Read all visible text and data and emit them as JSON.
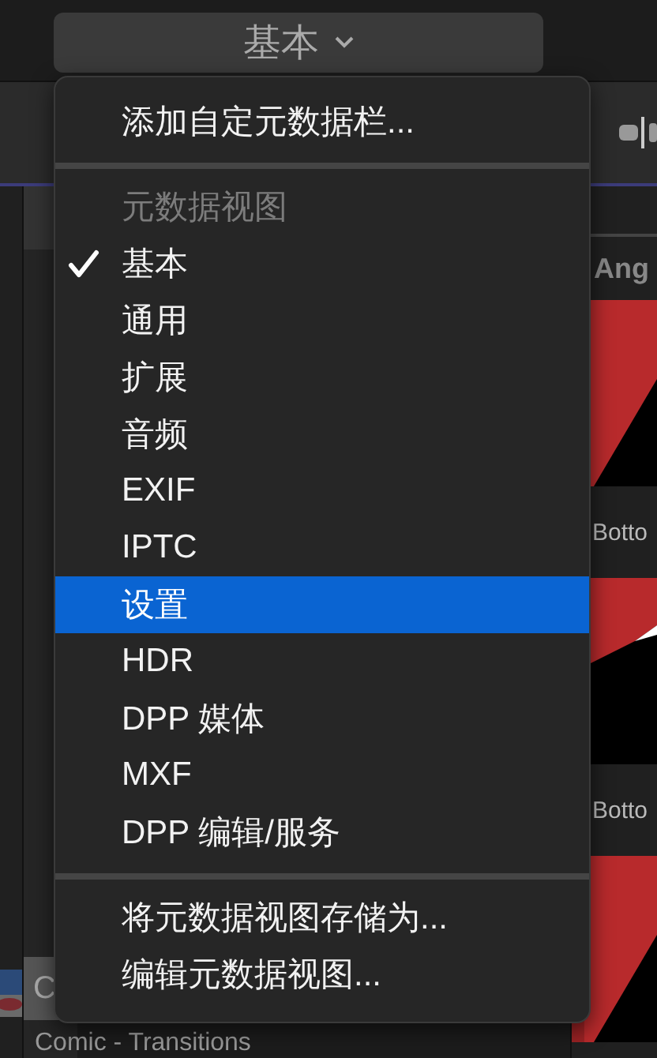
{
  "header_button": {
    "label": "基本"
  },
  "sidebar": {
    "items": [
      {
        "label": "C",
        "selected": true
      }
    ]
  },
  "browser": {
    "column_header": "Ang",
    "clips": [
      {
        "kind": "picture",
        "name": "Botto"
      },
      {
        "kind": "picture",
        "name": "Botto"
      },
      {
        "kind": "picture"
      }
    ],
    "footer_label": "Comic - Transitions"
  },
  "menu": {
    "items": [
      {
        "kind": "action",
        "label": "添加自定元数据栏..."
      },
      {
        "kind": "separator"
      },
      {
        "kind": "header",
        "label": "元数据视图"
      },
      {
        "kind": "view",
        "label": "基本",
        "checked": true,
        "selected": false
      },
      {
        "kind": "view",
        "label": "通用",
        "checked": false,
        "selected": false
      },
      {
        "kind": "view",
        "label": "扩展",
        "checked": false,
        "selected": false
      },
      {
        "kind": "view",
        "label": "音频",
        "checked": false,
        "selected": false
      },
      {
        "kind": "view",
        "label": "EXIF",
        "checked": false,
        "selected": false
      },
      {
        "kind": "view",
        "label": "IPTC",
        "checked": false,
        "selected": false
      },
      {
        "kind": "view",
        "label": "设置",
        "checked": false,
        "selected": true
      },
      {
        "kind": "view",
        "label": "HDR",
        "checked": false,
        "selected": false
      },
      {
        "kind": "view",
        "label": "DPP 媒体",
        "checked": false,
        "selected": false
      },
      {
        "kind": "view",
        "label": "MXF",
        "checked": false,
        "selected": false
      },
      {
        "kind": "view",
        "label": "DPP 编辑/服务",
        "checked": false,
        "selected": false
      },
      {
        "kind": "separator"
      },
      {
        "kind": "action",
        "label": "将元数据视图存储为..."
      },
      {
        "kind": "action",
        "label": "编辑元数据视图..."
      }
    ]
  }
}
